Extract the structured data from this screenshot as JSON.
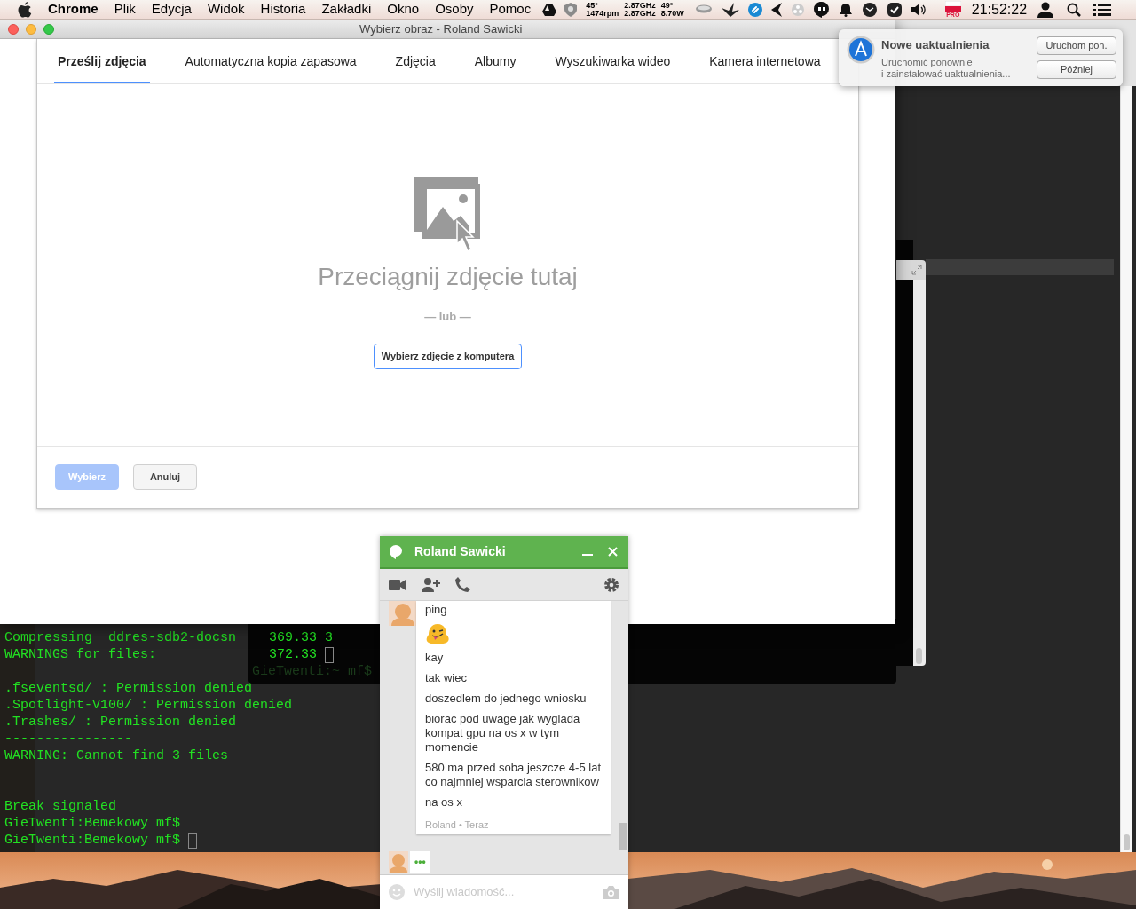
{
  "menu_bar": {
    "app": "Chrome",
    "menus": [
      "Plik",
      "Edycja",
      "Widok",
      "Historia",
      "Zakładki",
      "Okno",
      "Osoby",
      "Pomoc"
    ],
    "stats": [
      {
        "top": "45°",
        "bottom": "1474rpm"
      },
      {
        "top": "2.87GHz",
        "bottom": "2.87GHz"
      },
      {
        "top": "49°",
        "bottom": "8.70W"
      }
    ],
    "flag_badge": "PRO",
    "clock": "21:52:22"
  },
  "chrome_window": {
    "title": "Wybierz obraz - Roland Sawicki",
    "tabs": [
      {
        "label": "Prześlij zdjęcia",
        "selected": true
      },
      {
        "label": "Automatyczna kopia zapasowa",
        "selected": false
      },
      {
        "label": "Zdjęcia",
        "selected": false
      },
      {
        "label": "Albumy",
        "selected": false
      },
      {
        "label": "Wyszukiwarka wideo",
        "selected": false
      },
      {
        "label": "Kamera internetowa",
        "selected": false
      }
    ],
    "drop_text": "Przeciągnij zdjęcie tutaj",
    "or_text": "— lub —",
    "pick_button": "Wybierz zdjęcie z komputera",
    "footer_buttons": [
      {
        "label": "Wybierz",
        "kind": "primary",
        "disabled": true
      },
      {
        "label": "Anuluj",
        "kind": "secondary",
        "disabled": false
      }
    ]
  },
  "notification": {
    "title": "Nowe uaktualnienia",
    "body": [
      "Uruchomić ponownie",
      "i zainstalować uaktualnienia..."
    ],
    "buttons": [
      "Uruchom pon.",
      "Później"
    ]
  },
  "terminal": {
    "groups": [
      [
        "Compressing  ddres-sdb2-docsn",
        "WARNINGS for files:"
      ],
      [
        ".fseventsd/ : Permission denied",
        ".Spotlight-V100/ : Permission denied",
        ".Trashes/ : Permission denied",
        "----------------",
        "WARNING: Cannot find 3 files"
      ],
      [
        "Break signaled",
        "GieTwenti:Bemekowy mf$",
        "GieTwenti:Bemekowy mf$"
      ]
    ]
  },
  "back_terminal": {
    "lines": [
      "369.33 3",
      "372.33"
    ],
    "faint_line": "GieTwenti:~ mf$"
  },
  "chat": {
    "title": "Roland Sawicki",
    "messages": [
      {
        "kind": "text",
        "text": "ping"
      },
      {
        "kind": "emoji"
      },
      {
        "kind": "text",
        "text": "kay"
      },
      {
        "kind": "text",
        "text": "tak wiec"
      },
      {
        "kind": "text",
        "text": "doszedlem do jednego wniosku"
      },
      {
        "kind": "text",
        "text": "biorac pod uwage jak wyglada kompat gpu na os x w tym momencie"
      },
      {
        "kind": "text",
        "text": "580 ma przed soba jeszcze 4-5 lat co najmniej wsparcia sterownikow"
      },
      {
        "kind": "text",
        "text": "na os x"
      }
    ],
    "meta": "Roland • Teraz",
    "typing": "•••",
    "placeholder": "Wyślij wiadomość..."
  }
}
